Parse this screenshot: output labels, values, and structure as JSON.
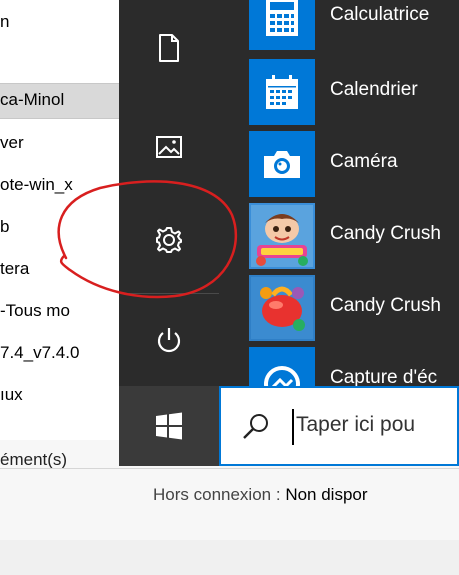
{
  "explorer": {
    "items": [
      "n",
      "ca-Minol",
      "ver",
      "ote-win_x",
      "b",
      "tera",
      "-Tous mo",
      "7.4_v7.4.0",
      "ıux"
    ],
    "status_count": "ément(s)",
    "status_label": "Hors connexion :",
    "status_value": "Non dispor"
  },
  "start_menu": {
    "rail": [
      {
        "icon": "document-icon"
      },
      {
        "icon": "pictures-icon"
      },
      {
        "icon": "settings-gear-icon"
      },
      {
        "icon": "power-icon"
      }
    ],
    "apps": [
      {
        "name": "Calculatrice",
        "icon": "calculator-icon"
      },
      {
        "name": "Calendrier",
        "icon": "calendar-icon"
      },
      {
        "name": "Caméra",
        "icon": "camera-icon"
      },
      {
        "name": "Candy Crush",
        "icon": "candy-crush-icon"
      },
      {
        "name": "Candy Crush",
        "icon": "candy-crush-soda-icon"
      },
      {
        "name": "Capture d'éc",
        "icon": "snip-icon"
      }
    ]
  },
  "taskbar": {
    "search_placeholder": "Taper ici pou",
    "start_icon": "windows-logo-icon"
  },
  "colors": {
    "start_bg": "#2b2b2b",
    "accent": "#0078d7",
    "annotation": "#d81f1f"
  }
}
